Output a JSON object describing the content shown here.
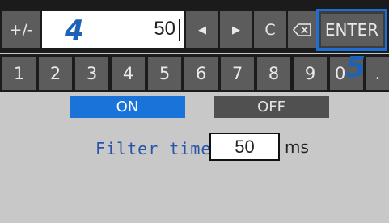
{
  "keypad": {
    "sign_label": "+/-",
    "entry_value": "50",
    "left_arrow": "◀",
    "right_arrow": "▶",
    "clear_label": "C",
    "backspace_icon": "backspace-icon",
    "enter_label": "ENTER",
    "digits": [
      "1",
      "2",
      "3",
      "4",
      "5",
      "6",
      "7",
      "8",
      "9",
      "0",
      "."
    ]
  },
  "callouts": {
    "step4": "4",
    "step5": "5"
  },
  "toggle": {
    "on_label": "ON",
    "off_label": "OFF",
    "selected": "ON"
  },
  "filter": {
    "label": "Filter time",
    "value": "50",
    "unit": "ms"
  },
  "colors": {
    "selected": "#1a73d9",
    "unselected": "#505050",
    "callout": "#1c63b8",
    "label": "#2855a8"
  }
}
